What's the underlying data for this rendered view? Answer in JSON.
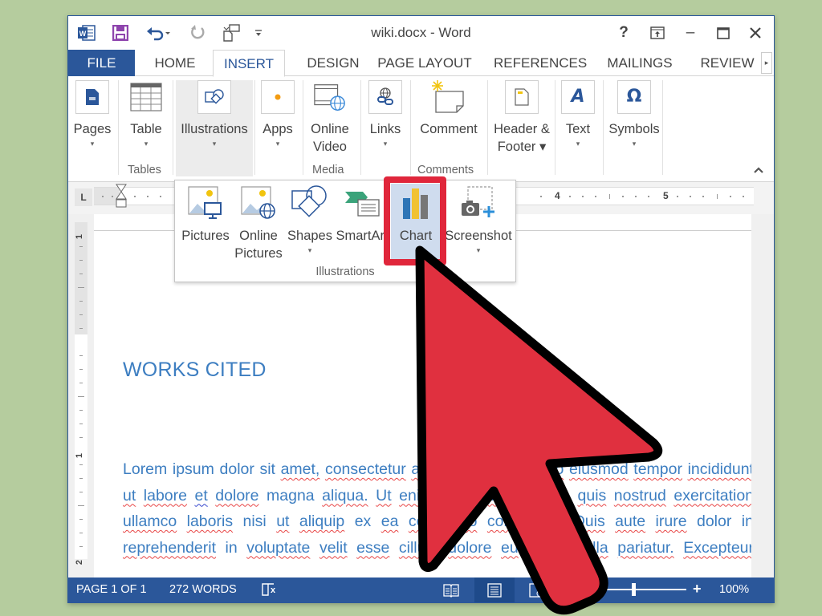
{
  "window": {
    "title": "wiki.docx - Word",
    "quick_access": [
      {
        "name": "word-app-icon"
      },
      {
        "name": "save-icon"
      },
      {
        "name": "undo-icon"
      },
      {
        "name": "redo-icon"
      },
      {
        "name": "touch-mode-icon"
      },
      {
        "name": "customize-qat-icon"
      }
    ],
    "controls": {
      "help": "?",
      "ribbon_display": "⊡",
      "minimize": "–",
      "maximize": "☐",
      "close": "✕"
    }
  },
  "tabs": [
    {
      "label": "FILE"
    },
    {
      "label": "HOME"
    },
    {
      "label": "INSERT",
      "active": true
    },
    {
      "label": "DESIGN"
    },
    {
      "label": "PAGE LAYOUT"
    },
    {
      "label": "REFERENCES"
    },
    {
      "label": "MAILINGS"
    },
    {
      "label": "REVIEW"
    }
  ],
  "tab_scroll": "▸",
  "ribbon": {
    "buttons": {
      "pages": {
        "label": "Pages",
        "caret": "▾"
      },
      "table": {
        "label": "Table",
        "caret": "▾"
      },
      "illustrations": {
        "label": "Illustrations",
        "caret": "▾"
      },
      "apps": {
        "label": "Apps",
        "caret": "▾"
      },
      "online_video": {
        "label1": "Online",
        "label2": "Video"
      },
      "links": {
        "label": "Links",
        "caret": "▾"
      },
      "comment": {
        "label": "Comment"
      },
      "header_footer": {
        "label1": "Header &",
        "label2": "Footer ▾"
      },
      "text": {
        "label": "Text",
        "caret": "▾"
      },
      "symbols": {
        "label": "Symbols",
        "caret": "▾"
      }
    },
    "groups": {
      "tables": "Tables",
      "media": "Media",
      "comments": "Comments"
    },
    "collapse": "^"
  },
  "ruler": {
    "tab_selector": "L",
    "numbers": [
      "4",
      "5"
    ],
    "vertical_numbers": [
      "1",
      "1",
      "2"
    ]
  },
  "illustrations_menu": {
    "items": [
      {
        "label1": "Pictures",
        "label2": ""
      },
      {
        "label1": "Online",
        "label2": "Pictures"
      },
      {
        "label1": "Shapes",
        "caret": "▾"
      },
      {
        "label1": "SmartArt"
      },
      {
        "label1": "Chart"
      },
      {
        "label1": "Screenshot",
        "caret": "▾"
      }
    ],
    "group_label": "Illustrations",
    "highlighted": "Chart"
  },
  "document": {
    "heading": "WORKS CITED",
    "lines": [
      "Lorem ipsum dolor sit amet, consectetur adipiscing elit, sed do eiusmod tempor incididunt",
      "ut labore et dolore magna aliqua. Ut enim ad minim veniam, quis nostrud exercitation",
      "ullamco laboris nisi ut aliquip ex ea commodo consequat. Duis aute irure dolor in",
      "reprehenderit in voluptate velit esse cillum dolore eu fugiat nulla pariatur. Excepteur"
    ]
  },
  "statusbar": {
    "page": "PAGE 1 OF 1",
    "words": "272 WORDS",
    "zoom_minus": "–",
    "zoom_plus": "+",
    "zoom_level": "100%",
    "zoom_percent": 100
  },
  "colors": {
    "accent": "#2b579a",
    "highlight": "#e0263b",
    "heading": "#3d7ec1",
    "background": "#b5cc9e"
  }
}
